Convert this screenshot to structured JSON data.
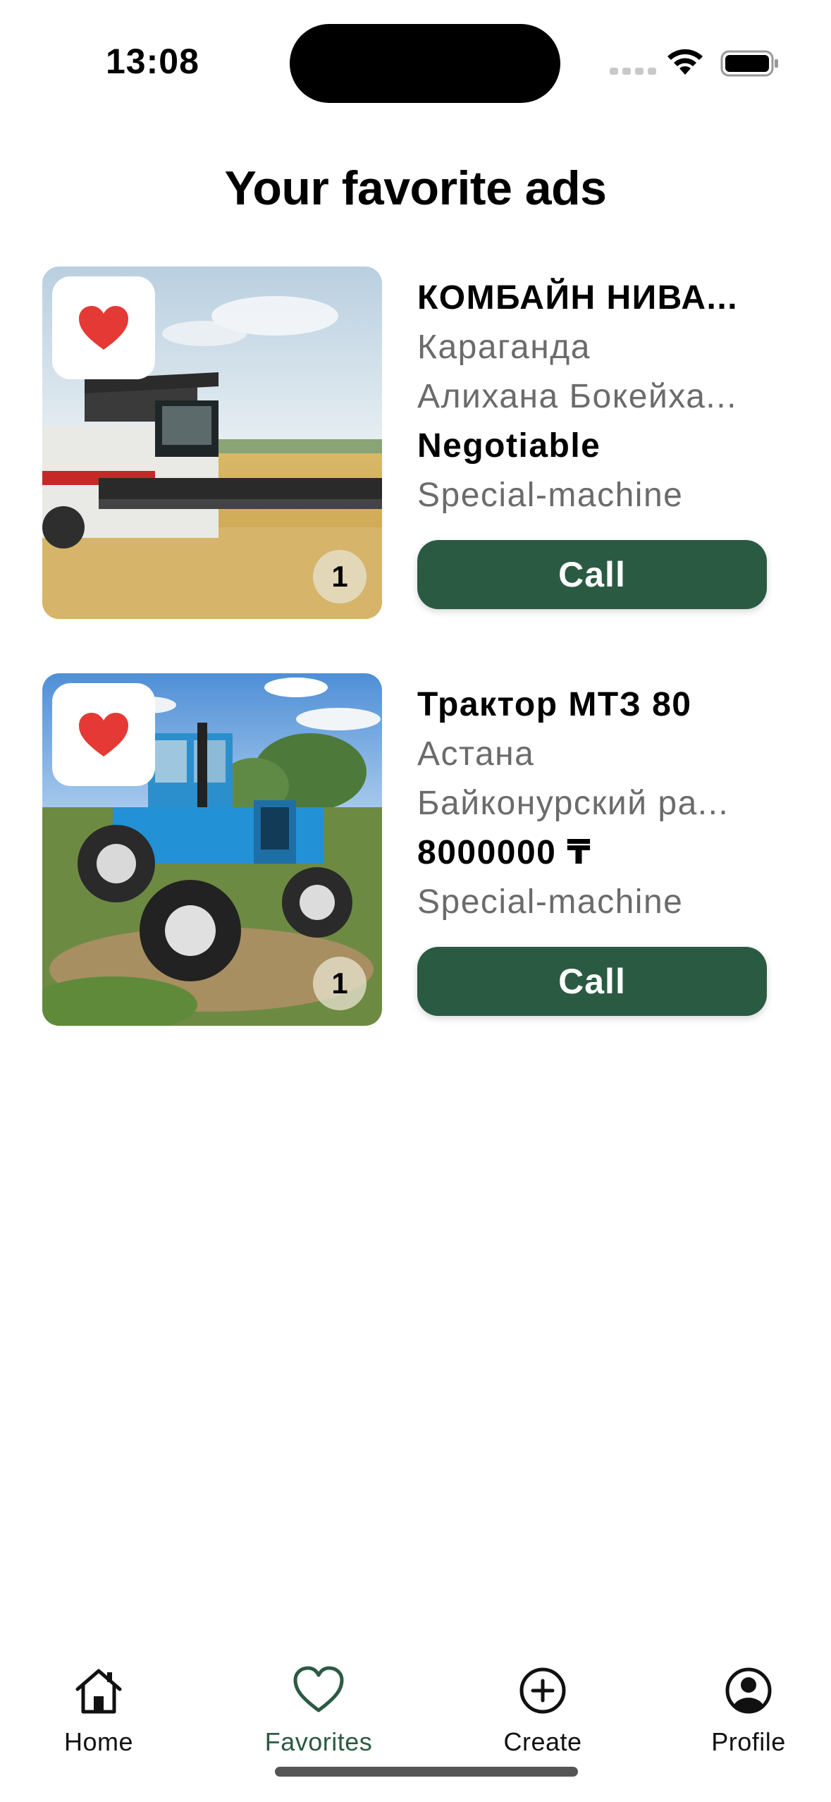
{
  "status_bar": {
    "time": "13:08"
  },
  "page": {
    "title": "Your favorite ads"
  },
  "ads": [
    {
      "title": "КОМБАЙН НИВА...",
      "city": "Караганда",
      "address": "Алихана Бокейха...",
      "price": "Negotiable",
      "category": "Special-machine",
      "photo_count": "1",
      "call_label": "Call",
      "favorite": true,
      "image": "combine-harvester-photo"
    },
    {
      "title": "Трактор МТЗ 80",
      "city": "Астана",
      "address": "Байконурский ра...",
      "price": "8000000 ₸",
      "category": "Special-machine",
      "photo_count": "1",
      "call_label": "Call",
      "favorite": true,
      "image": "blue-tractor-photo"
    }
  ],
  "tab_bar": {
    "tabs": [
      {
        "label": "Home",
        "icon": "house-icon",
        "active": false
      },
      {
        "label": "Favorites",
        "icon": "heart-outline-icon",
        "active": true
      },
      {
        "label": "Create",
        "icon": "plus-circle-icon",
        "active": false
      },
      {
        "label": "Profile",
        "icon": "person-circle-icon",
        "active": false
      }
    ]
  },
  "colors": {
    "accent": "#2b5a43",
    "heart": "#e53935",
    "secondary_text": "#6b6b6b"
  }
}
